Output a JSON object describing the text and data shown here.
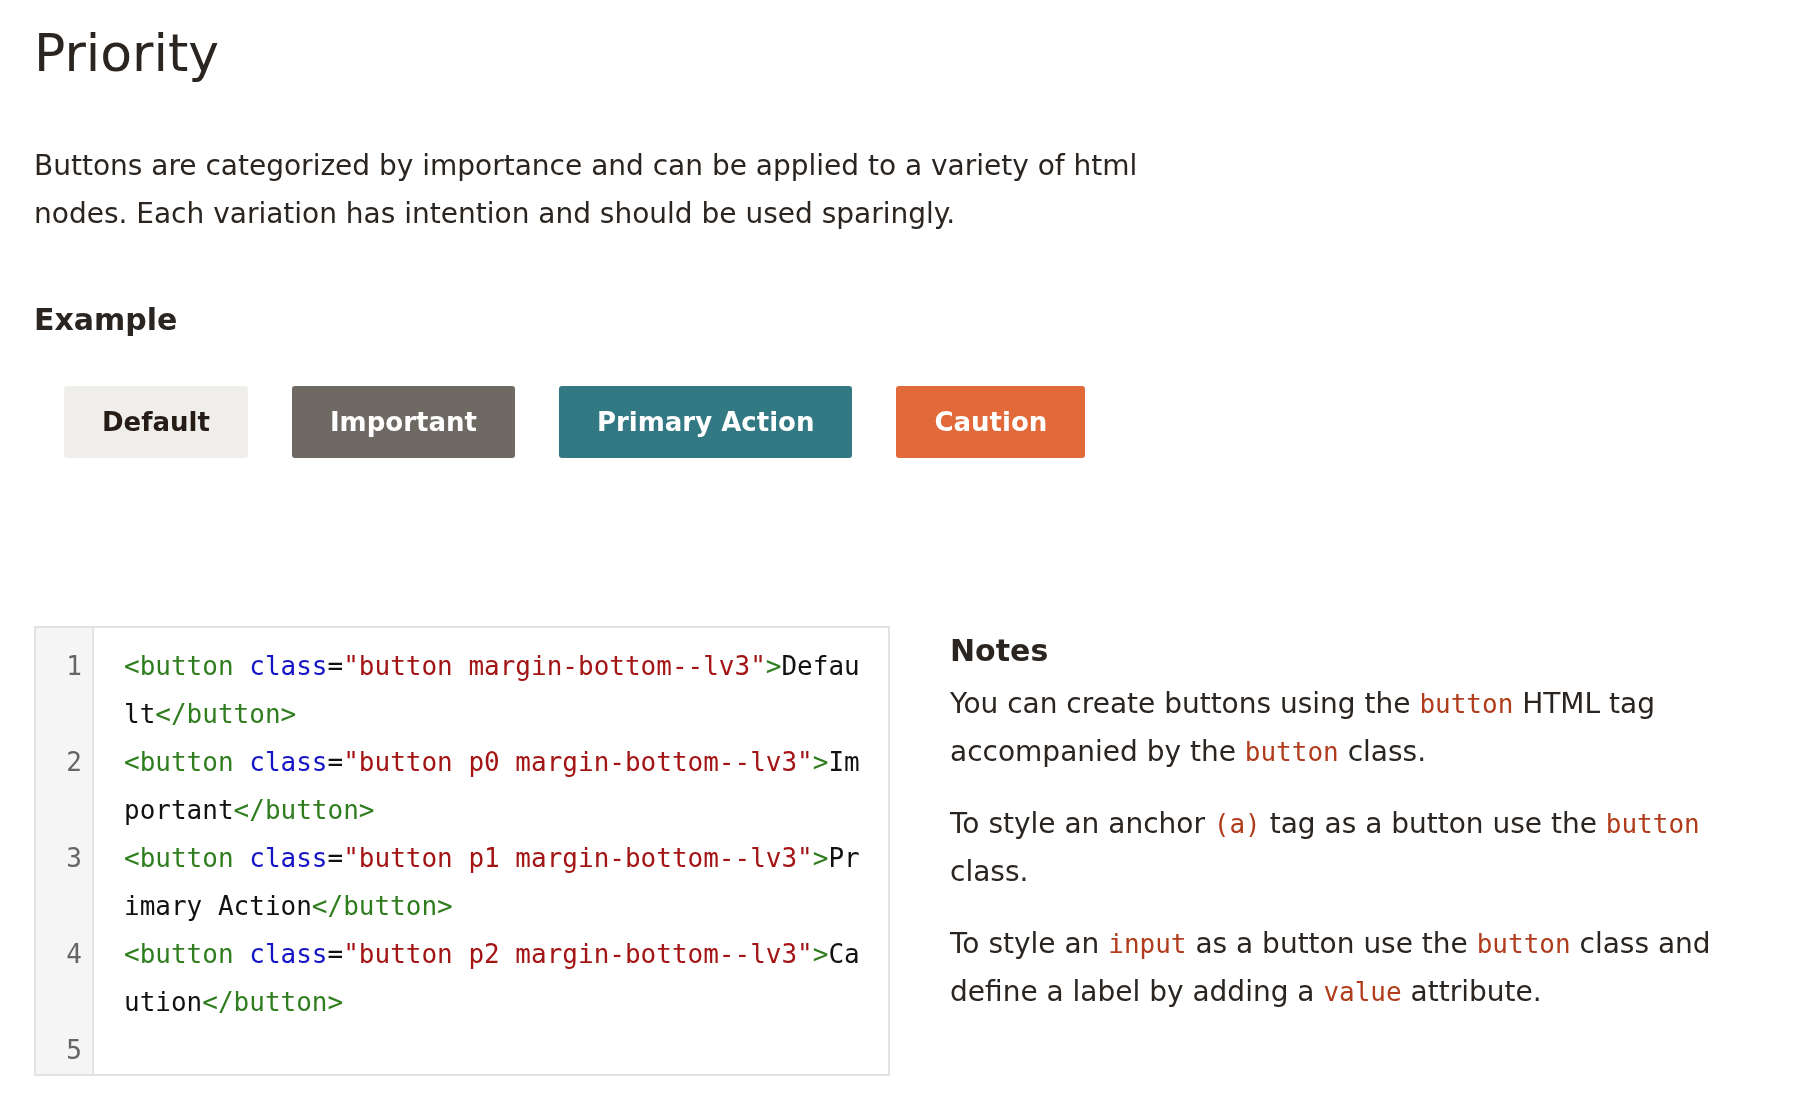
{
  "title": "Priority",
  "intro": "Buttons are categorized by importance and can be applied to a variety of html nodes. Each variation has intention and should be used sparingly.",
  "example_heading": "Example",
  "buttons": [
    {
      "label": "Default",
      "kind": "default"
    },
    {
      "label": "Important",
      "kind": "important"
    },
    {
      "label": "Primary Action",
      "kind": "primary"
    },
    {
      "label": "Caution",
      "kind": "caution"
    }
  ],
  "code": [
    {
      "number": "1",
      "tokens": [
        {
          "kind": "tag",
          "text": "<button "
        },
        {
          "kind": "attr",
          "text": "class"
        },
        {
          "kind": "plain",
          "text": "="
        },
        {
          "kind": "string",
          "text": "\"button margin-bottom--lv3\""
        },
        {
          "kind": "tag",
          "text": ">"
        },
        {
          "kind": "plain",
          "text": "Default"
        },
        {
          "kind": "tag",
          "text": "</button>"
        }
      ]
    },
    {
      "number": "2",
      "tokens": [
        {
          "kind": "tag",
          "text": "<button "
        },
        {
          "kind": "attr",
          "text": "class"
        },
        {
          "kind": "plain",
          "text": "="
        },
        {
          "kind": "string",
          "text": "\"button p0 margin-bottom--lv3\""
        },
        {
          "kind": "tag",
          "text": ">"
        },
        {
          "kind": "plain",
          "text": "Important"
        },
        {
          "kind": "tag",
          "text": "</button>"
        }
      ]
    },
    {
      "number": "3",
      "tokens": [
        {
          "kind": "tag",
          "text": "<button "
        },
        {
          "kind": "attr",
          "text": "class"
        },
        {
          "kind": "plain",
          "text": "="
        },
        {
          "kind": "string",
          "text": "\"button p1 margin-bottom--lv3\""
        },
        {
          "kind": "tag",
          "text": ">"
        },
        {
          "kind": "plain",
          "text": "Primary Action"
        },
        {
          "kind": "tag",
          "text": "</button>"
        }
      ]
    },
    {
      "number": "4",
      "tokens": [
        {
          "kind": "tag",
          "text": "<button "
        },
        {
          "kind": "attr",
          "text": "class"
        },
        {
          "kind": "plain",
          "text": "="
        },
        {
          "kind": "string",
          "text": "\"button p2 margin-bottom--lv3\""
        },
        {
          "kind": "tag",
          "text": ">"
        },
        {
          "kind": "plain",
          "text": "Caution"
        },
        {
          "kind": "tag",
          "text": "</button>"
        }
      ]
    },
    {
      "number": "5"
    }
  ],
  "notes": {
    "heading": "Notes",
    "paragraphs": [
      [
        {
          "kind": "text",
          "text": "You can create buttons using the "
        },
        {
          "kind": "code",
          "text": "button"
        },
        {
          "kind": "text",
          "text": " HTML tag accompanied by the "
        },
        {
          "kind": "code",
          "text": "button"
        },
        {
          "kind": "text",
          "text": " class."
        }
      ],
      [
        {
          "kind": "text",
          "text": "To style an anchor "
        },
        {
          "kind": "code",
          "text": "(a)"
        },
        {
          "kind": "text",
          "text": " tag as a button use the "
        },
        {
          "kind": "code",
          "text": "button"
        },
        {
          "kind": "text",
          "text": " class."
        }
      ],
      [
        {
          "kind": "text",
          "text": "To style an "
        },
        {
          "kind": "code",
          "text": "input"
        },
        {
          "kind": "text",
          "text": " as a button use the "
        },
        {
          "kind": "code",
          "text": "button"
        },
        {
          "kind": "text",
          "text": " class and define a label by adding a "
        },
        {
          "kind": "code",
          "text": "value"
        },
        {
          "kind": "text",
          "text": " attribute."
        }
      ]
    ]
  }
}
